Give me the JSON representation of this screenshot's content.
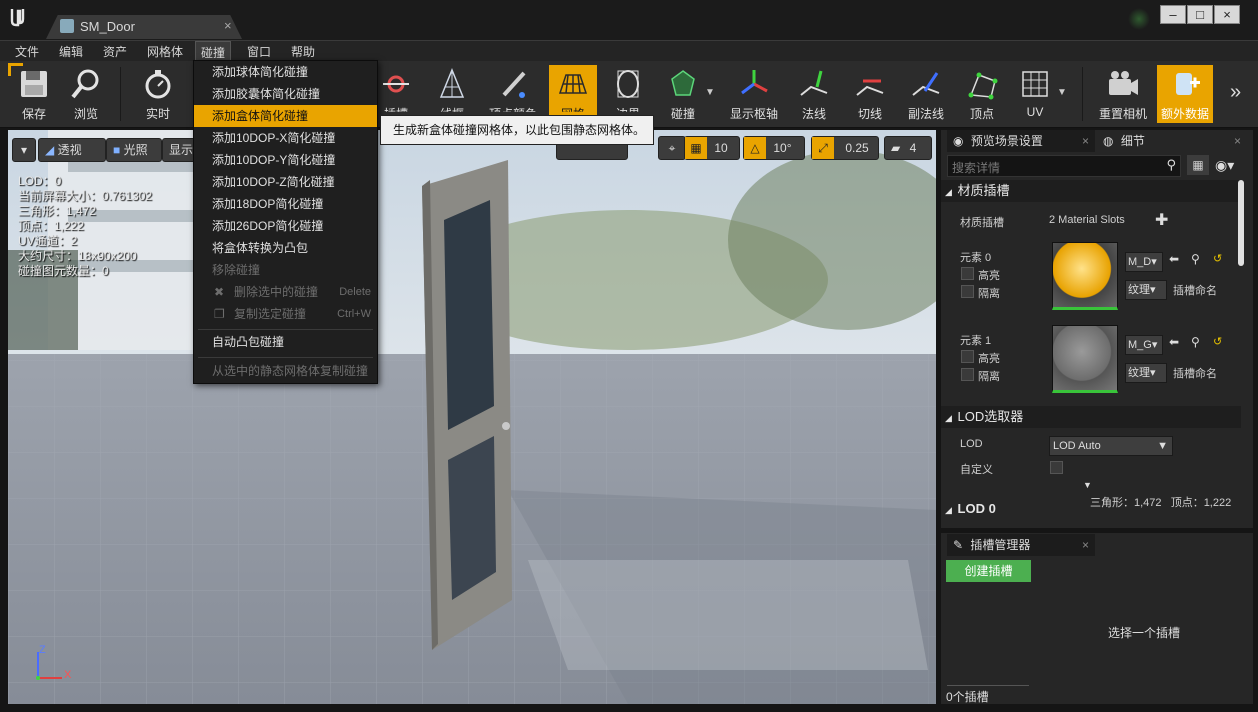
{
  "titlebar": {
    "tab_title": "SM_Door",
    "close": "×",
    "window_buttons": [
      "–",
      "□",
      "×"
    ]
  },
  "menubar": {
    "items": [
      "文件",
      "编辑",
      "资产",
      "网格体",
      "碰撞",
      "窗口",
      "帮助"
    ]
  },
  "toolbar": {
    "items": [
      "保存",
      "浏览",
      "实时",
      "插槽",
      "线框",
      "顶点颜色",
      "网格",
      "边界",
      "碰撞",
      "显示枢轴",
      "法线",
      "切线",
      "副法线",
      "顶点",
      "UV",
      "重置相机",
      "额外数据"
    ]
  },
  "collision_menu": {
    "items": [
      {
        "label": "添加球体简化碰撞",
        "shortcut": "",
        "state": "normal"
      },
      {
        "label": "添加胶囊体简化碰撞",
        "shortcut": "",
        "state": "normal"
      },
      {
        "label": "添加盒体简化碰撞",
        "shortcut": "",
        "state": "highlighted"
      },
      {
        "label": "添加10DOP-X简化碰撞",
        "shortcut": "",
        "state": "normal"
      },
      {
        "label": "添加10DOP-Y简化碰撞",
        "shortcut": "",
        "state": "normal"
      },
      {
        "label": "添加10DOP-Z简化碰撞",
        "shortcut": "",
        "state": "normal"
      },
      {
        "label": "添加18DOP简化碰撞",
        "shortcut": "",
        "state": "normal"
      },
      {
        "label": "添加26DOP简化碰撞",
        "shortcut": "",
        "state": "normal"
      },
      {
        "label": "将盒体转换为凸包",
        "shortcut": "",
        "state": "normal"
      },
      {
        "label": "移除碰撞",
        "shortcut": "",
        "state": "disabled"
      },
      {
        "label": "删除选中的碰撞",
        "shortcut": "Delete",
        "state": "disabled"
      },
      {
        "label": "复制选定碰撞",
        "shortcut": "Ctrl+W",
        "state": "disabled"
      },
      {
        "label": "自动凸包碰撞",
        "shortcut": "",
        "state": "normal"
      },
      {
        "label": "从选中的静态网格体复制碰撞",
        "shortcut": "",
        "state": "disabled"
      }
    ],
    "tooltip": "生成新盒体碰撞网格体，以此包围静态网格体。"
  },
  "viewport": {
    "perspective_label": "透视",
    "lighting_label": "光照",
    "show_label": "显示",
    "grid_snap": "10",
    "rotation_snap": "10°",
    "scale_snap": "0.25",
    "camera_speed": "4",
    "stats": [
      "LOD：0",
      "当前屏幕大小：0.761302",
      "三角形：1,472",
      "顶点：1,222",
      "UV通道：2",
      "大约尺寸：18x90x200",
      "碰撞图元数量：0"
    ],
    "axis_z": "Z",
    "axis_x": "X"
  },
  "details_panel": {
    "tab_preview": "预览场景设置",
    "tab_details": "细节",
    "search_placeholder": "搜索详情",
    "material_section": "材质插槽",
    "material_slots_label": "材质插槽",
    "material_slots_value": "2 Material Slots",
    "elements": [
      {
        "label": "元素 0",
        "material": "M_D",
        "highlight": "高亮",
        "isolate": "隔离",
        "texture": "纹理",
        "slot_name": "插槽命名"
      },
      {
        "label": "元素 1",
        "material": "M_G",
        "highlight": "高亮",
        "isolate": "隔离",
        "texture": "纹理",
        "slot_name": "插槽命名"
      }
    ],
    "lod_picker_section": "LOD选取器",
    "lod_label": "LOD",
    "lod_value": "LOD Auto",
    "custom_label": "自定义",
    "lod_stats": "三角形：1,472   顶点：1,222",
    "lod0_section": "LOD 0"
  },
  "socket_panel": {
    "title": "插槽管理器",
    "create_button": "创建插槽",
    "empty_text": "选择一个插槽",
    "count": "0个插槽"
  },
  "colors": {
    "accent": "#e9a400",
    "create_button": "#4caf50"
  }
}
